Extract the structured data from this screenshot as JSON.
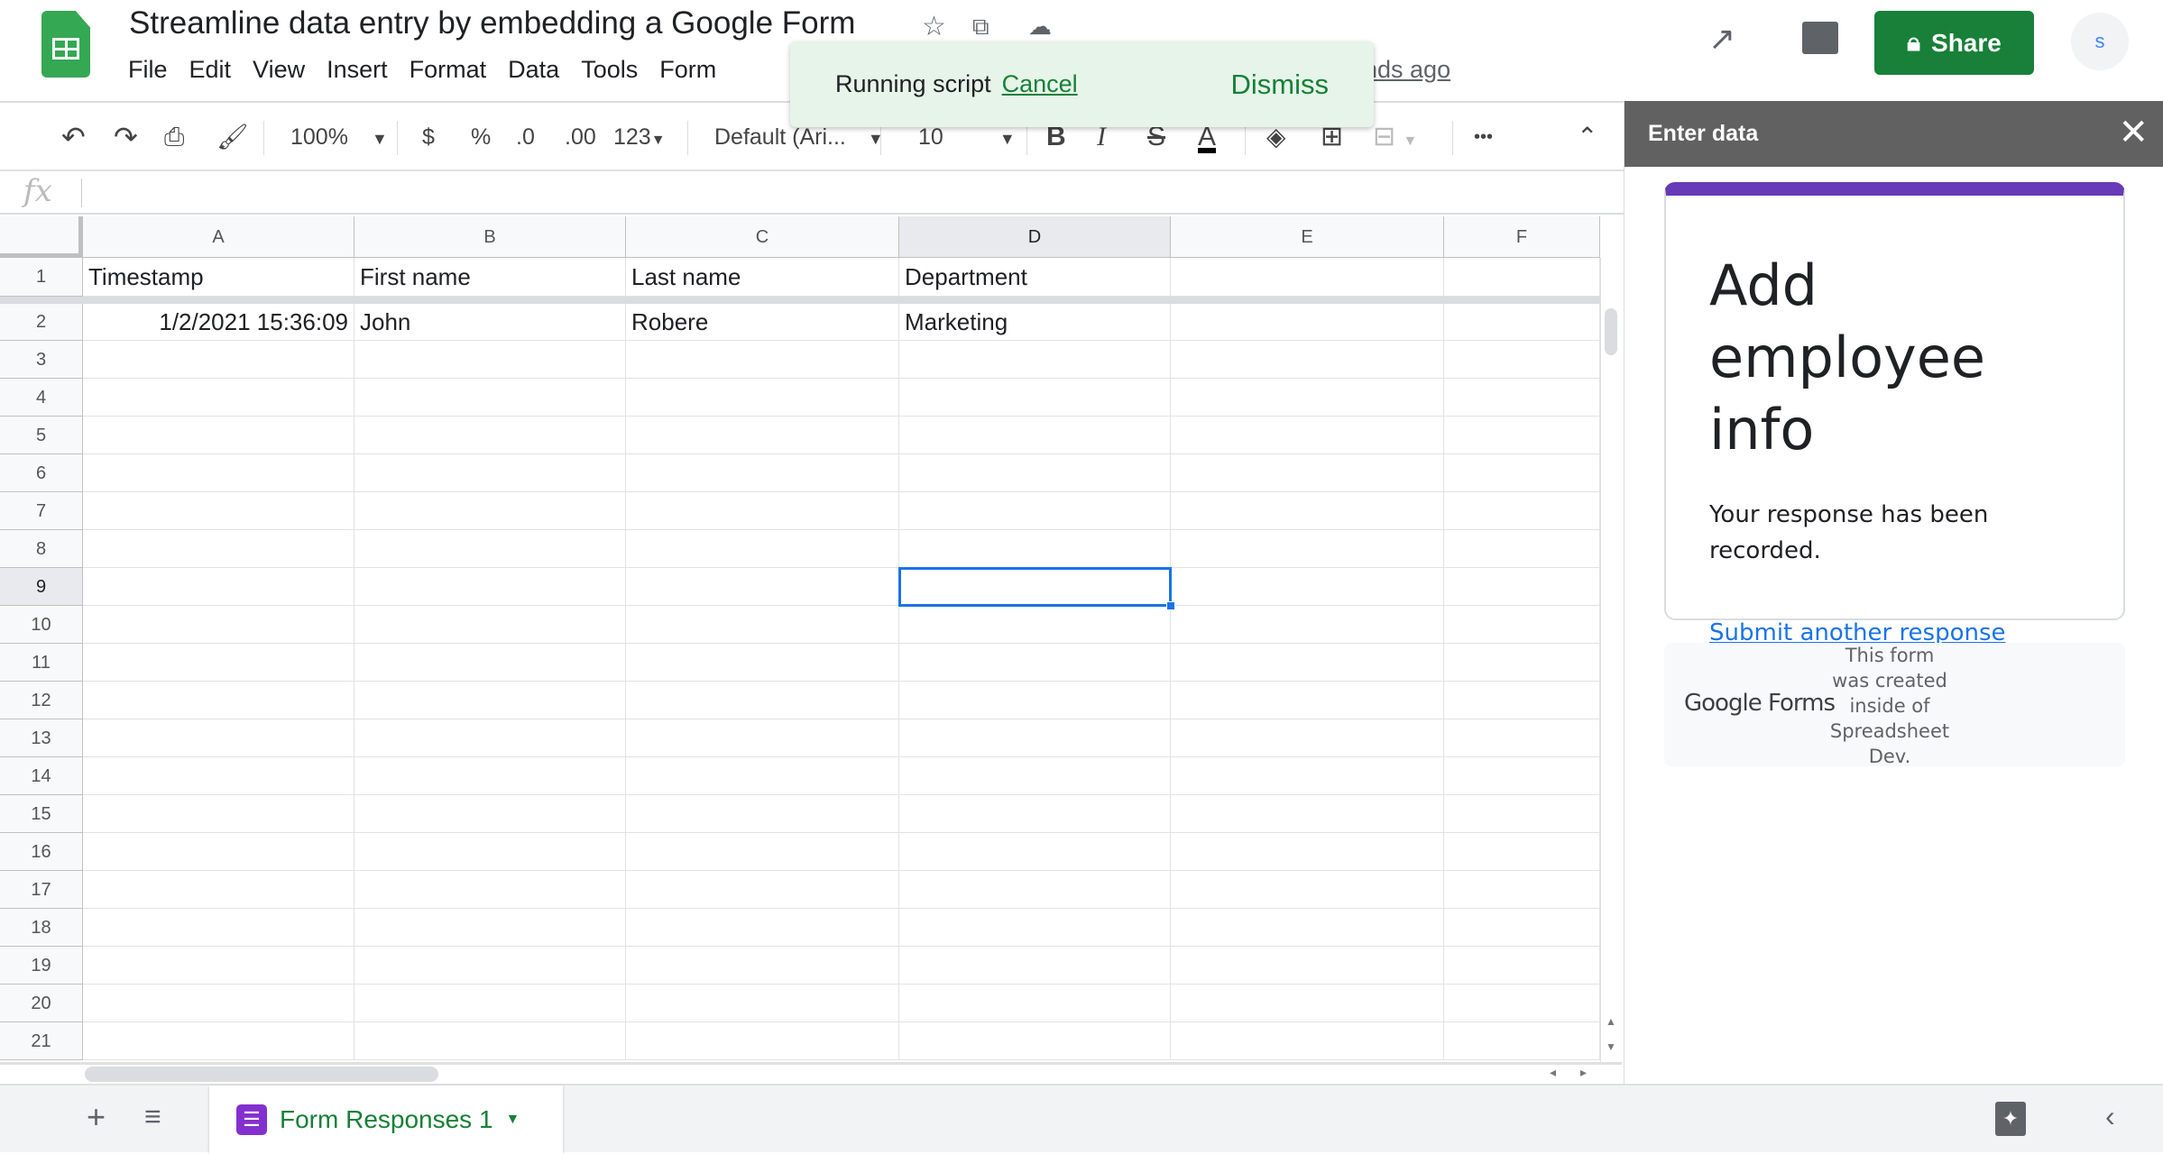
{
  "app": {
    "title": "Streamline data entry by embedding a Google Form",
    "last_edit": "nds ago",
    "menu": [
      "File",
      "Edit",
      "View",
      "Insert",
      "Format",
      "Data",
      "Tools",
      "Form"
    ],
    "share_label": "Share",
    "avatar_initial": "s"
  },
  "toast": {
    "message": "Running script",
    "cancel": "Cancel",
    "dismiss": "Dismiss"
  },
  "toolbar": {
    "zoom": "100%",
    "currency": "$",
    "percent": "%",
    "dec_decrease": ".0",
    "dec_increase": ".00",
    "more_formats": "123",
    "font": "Default (Ari...",
    "font_size": "10",
    "bold": "B",
    "italic": "I",
    "strike": "S",
    "text_color": "A",
    "text_color_value": "#000000",
    "more": "•••"
  },
  "formula_bar": {
    "fx": "fx",
    "value": ""
  },
  "grid": {
    "columns": [
      "A",
      "B",
      "C",
      "D",
      "E",
      "F"
    ],
    "selected_column": "D",
    "selected_row": 9,
    "rows": [
      {
        "n": "1",
        "cells": [
          "Timestamp",
          "First name",
          "Last name",
          "Department",
          "",
          ""
        ]
      },
      {
        "n": "2",
        "cells": [
          "1/2/2021 15:36:09",
          "John",
          "Robere",
          "Marketing",
          "",
          ""
        ]
      },
      {
        "n": "3",
        "cells": []
      },
      {
        "n": "4",
        "cells": []
      },
      {
        "n": "5",
        "cells": []
      },
      {
        "n": "6",
        "cells": []
      },
      {
        "n": "7",
        "cells": []
      },
      {
        "n": "8",
        "cells": []
      },
      {
        "n": "9",
        "cells": []
      },
      {
        "n": "10",
        "cells": []
      },
      {
        "n": "11",
        "cells": []
      },
      {
        "n": "12",
        "cells": []
      },
      {
        "n": "13",
        "cells": []
      },
      {
        "n": "14",
        "cells": []
      },
      {
        "n": "15",
        "cells": []
      },
      {
        "n": "16",
        "cells": []
      },
      {
        "n": "17",
        "cells": []
      },
      {
        "n": "18",
        "cells": []
      },
      {
        "n": "19",
        "cells": []
      },
      {
        "n": "20",
        "cells": []
      },
      {
        "n": "21",
        "cells": []
      }
    ]
  },
  "sheet_tabs": [
    {
      "label": "Form Responses 1",
      "active": true
    }
  ],
  "sidebar": {
    "title": "Enter data",
    "form": {
      "title": "Add employee info",
      "message": "Your response has been recorded.",
      "link": "Submit another response",
      "accent": "#673ab7"
    },
    "footer": {
      "brand": "Google Forms",
      "note": "This form was created inside of Spreadsheet Dev."
    }
  },
  "colors": {
    "share": "#188038",
    "toast_bg": "#e6f4ea",
    "selection": "#1a73e8",
    "sidebar_header": "#616161"
  }
}
